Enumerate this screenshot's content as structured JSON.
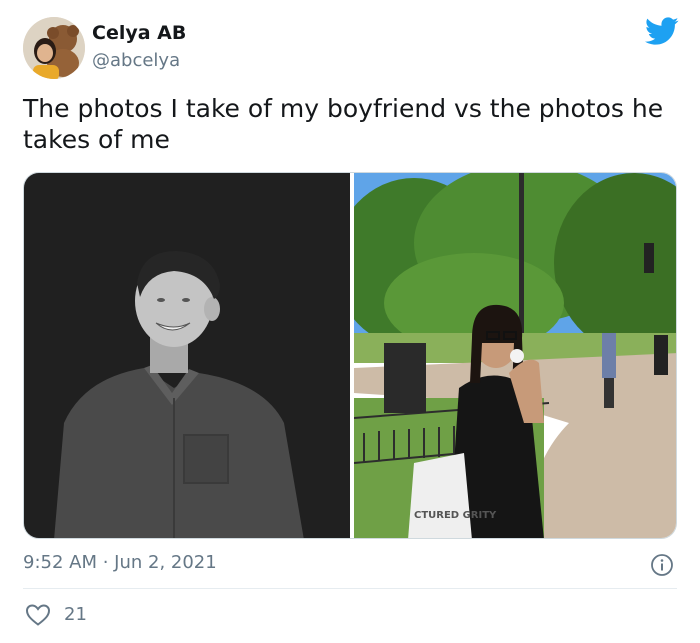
{
  "author": {
    "display_name": "Celya AB",
    "handle": "@abcelya",
    "avatar_icon": "profile-photo-with-teddy-bear"
  },
  "tweet": {
    "text": "The photos I take of my boyfriend vs the photos he takes of me",
    "timestamp": "9:52 AM · Jun 2, 2021",
    "like_count": "21"
  },
  "photos": [
    {
      "name": "boyfriend-portrait-bw",
      "style": "black and white"
    },
    {
      "name": "girlfriend-park-photo",
      "style": "color",
      "bag_text": "CTURED GRITY"
    }
  ],
  "colors": {
    "brand": "#1da1f2",
    "secondary_text": "#657786",
    "primary_text": "#14171a",
    "divider": "#e6ecf0"
  },
  "icons": {
    "brand": "twitter-bird-icon",
    "info": "info-icon",
    "like": "heart-outline-icon"
  }
}
